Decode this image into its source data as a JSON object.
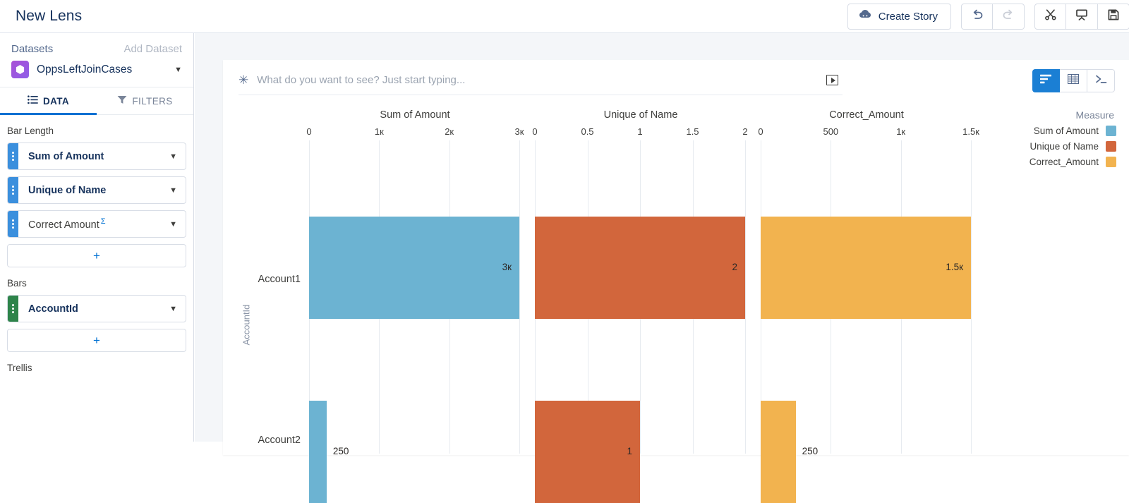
{
  "header": {
    "title": "New Lens",
    "create_story_label": "Create Story",
    "buttons": [
      {
        "name": "undo-button",
        "icon": "undo-icon"
      },
      {
        "name": "redo-button",
        "icon": "redo-icon"
      },
      {
        "name": "clip-button",
        "icon": "scissors-icon"
      },
      {
        "name": "present-button",
        "icon": "easel-icon"
      },
      {
        "name": "save-button",
        "icon": "save-icon"
      }
    ]
  },
  "sidebar": {
    "datasets_label": "Datasets",
    "add_dataset_label": "Add Dataset",
    "dataset_name": "OppsLeftJoinCases",
    "tabs": [
      {
        "label": "DATA",
        "icon": "list-icon",
        "active": true
      },
      {
        "label": "FILTERS",
        "icon": "funnel-icon",
        "active": false
      }
    ],
    "bar_length_label": "Bar Length",
    "bar_length_fields": [
      {
        "label": "Sum of Amount",
        "type": "measure"
      },
      {
        "label": "Unique of Name",
        "type": "measure"
      },
      {
        "label": "Correct  Amount",
        "type": "measure",
        "suffix": "Σ"
      }
    ],
    "bars_label": "Bars",
    "bars_fields": [
      {
        "label": "AccountId",
        "type": "dimension"
      }
    ],
    "trellis_label": "Trellis",
    "add_label": "+"
  },
  "search": {
    "placeholder": "What do you want to see? Just start typing...",
    "value": ""
  },
  "viewtoggle": [
    {
      "name": "chart-view-button",
      "icon": "bar-chart-icon",
      "active": true
    },
    {
      "name": "table-view-button",
      "icon": "table-icon",
      "active": false
    },
    {
      "name": "query-view-button",
      "icon": "code-icon",
      "active": false
    }
  ],
  "chart_data": {
    "type": "bar",
    "title": "",
    "ylabel": "AccountId",
    "legend_title": "Measure",
    "legend_position": "right",
    "orientation": "horizontal",
    "grid": true,
    "categories": [
      "Account1",
      "Account2"
    ],
    "panels": [
      {
        "title": "Sum of Amount",
        "color": "#6CB3D2",
        "ticks": [
          "0",
          "1к",
          "2к",
          "3к"
        ],
        "tick_values": [
          0,
          1000,
          2000,
          3000
        ],
        "xlim": [
          0,
          3000
        ],
        "values": [
          3000,
          250
        ],
        "labels": [
          "3к",
          "250"
        ]
      },
      {
        "title": "Unique of Name",
        "color": "#D2663C",
        "ticks": [
          "0",
          "0.5",
          "1",
          "1.5",
          "2"
        ],
        "tick_values": [
          0,
          0.5,
          1,
          1.5,
          2
        ],
        "xlim": [
          0,
          2
        ],
        "values": [
          2,
          1
        ],
        "labels": [
          "2",
          "1"
        ]
      },
      {
        "title": "Correct_Amount",
        "color": "#F2B34F",
        "ticks": [
          "0",
          "500",
          "1к",
          "1.5к"
        ],
        "tick_values": [
          0,
          500,
          1000,
          1500
        ],
        "xlim": [
          0,
          1500
        ],
        "values": [
          1500,
          250
        ],
        "labels": [
          "1.5к",
          "250"
        ]
      }
    ],
    "legend": [
      {
        "label": "Sum of Amount",
        "color": "#6CB3D2"
      },
      {
        "label": "Unique of Name",
        "color": "#D2663C"
      },
      {
        "label": "Correct_Amount",
        "color": "#F2B34F"
      }
    ]
  }
}
